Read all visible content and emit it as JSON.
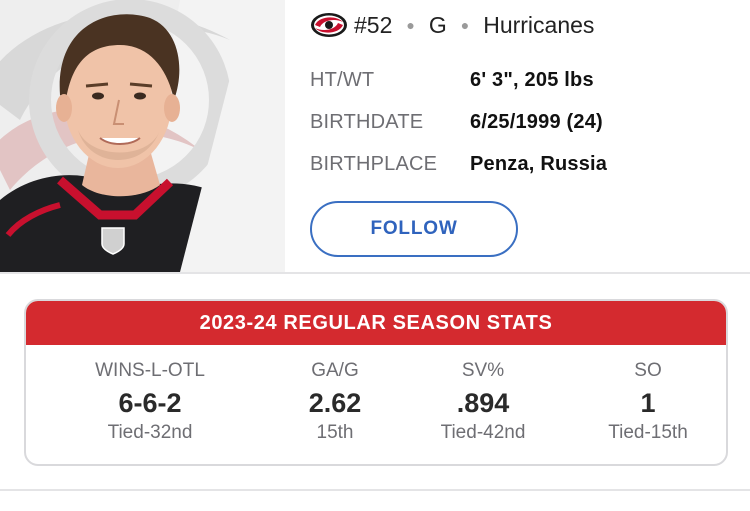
{
  "player": {
    "number": "#52",
    "position": "G",
    "team": "Hurricanes"
  },
  "bio": {
    "rows": [
      {
        "label": "HT/WT",
        "value": "6' 3\", 205 lbs"
      },
      {
        "label": "BIRTHDATE",
        "value": "6/25/1999 (24)"
      },
      {
        "label": "BIRTHPLACE",
        "value": "Penza, Russia"
      }
    ]
  },
  "follow_button": "FOLLOW",
  "stats": {
    "title": "2023-24 REGULAR SEASON STATS",
    "columns": [
      {
        "label": "WINS-L-OTL",
        "value": "6-6-2",
        "rank": "Tied-32nd"
      },
      {
        "label": "GA/G",
        "value": "2.62",
        "rank": "15th"
      },
      {
        "label": "SV%",
        "value": ".894",
        "rank": "Tied-42nd"
      },
      {
        "label": "SO",
        "value": "1",
        "rank": "Tied-15th"
      }
    ]
  },
  "colors": {
    "accent_red": "#d42a2f",
    "follow_blue": "#2f63bd",
    "label_gray": "#6e6e73"
  },
  "icons": {
    "team_logo": "hurricanes-logo-icon",
    "separator": "dot-separator-icon"
  }
}
